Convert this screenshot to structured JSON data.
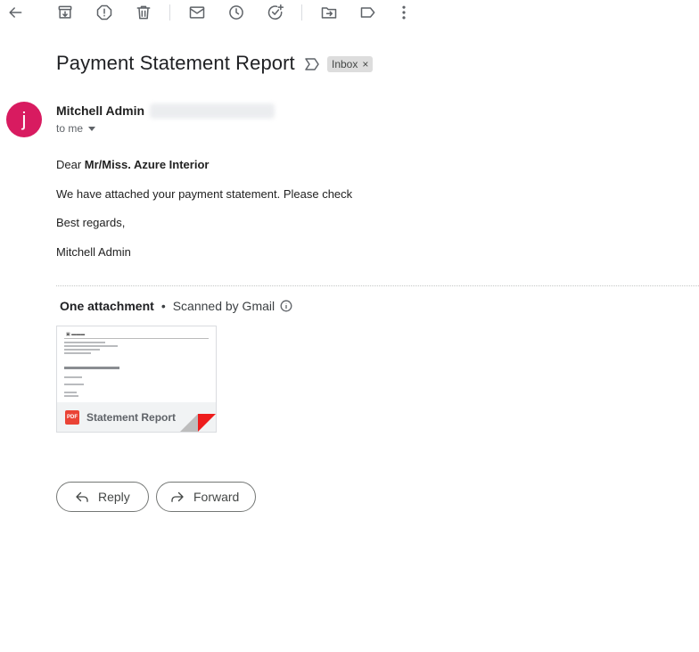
{
  "toolbar": {
    "icons": [
      "back-arrow-icon",
      "archive-icon",
      "report-spam-icon",
      "delete-icon",
      "mark-unread-icon",
      "snooze-icon",
      "add-task-icon",
      "move-to-icon",
      "label-icon",
      "more-vert-icon"
    ]
  },
  "email": {
    "subject": "Payment Statement Report",
    "label": "Inbox",
    "label_remove": "×",
    "sender": {
      "avatar_letter": "j",
      "avatar_color": "#d81b60",
      "name": "Mitchell Admin",
      "recipient": "to me"
    },
    "body": {
      "greeting_prefix": "Dear ",
      "greeting_name": "Mr/Miss. Azure Interior",
      "line1": "We have attached your payment statement. Please check",
      "line2": "Best regards,",
      "line3": "Mitchell Admin"
    }
  },
  "attachments": {
    "header": "One attachment",
    "separator": "•",
    "scan_text": "Scanned by Gmail",
    "file": {
      "type_label": "PDF",
      "name": "Statement Report"
    }
  },
  "actions": {
    "reply_label": "Reply",
    "forward_label": "Forward"
  },
  "colors": {
    "pdf_red": "#ea4335",
    "avatar": "#d81b60",
    "chip_bg": "#dddddd"
  }
}
